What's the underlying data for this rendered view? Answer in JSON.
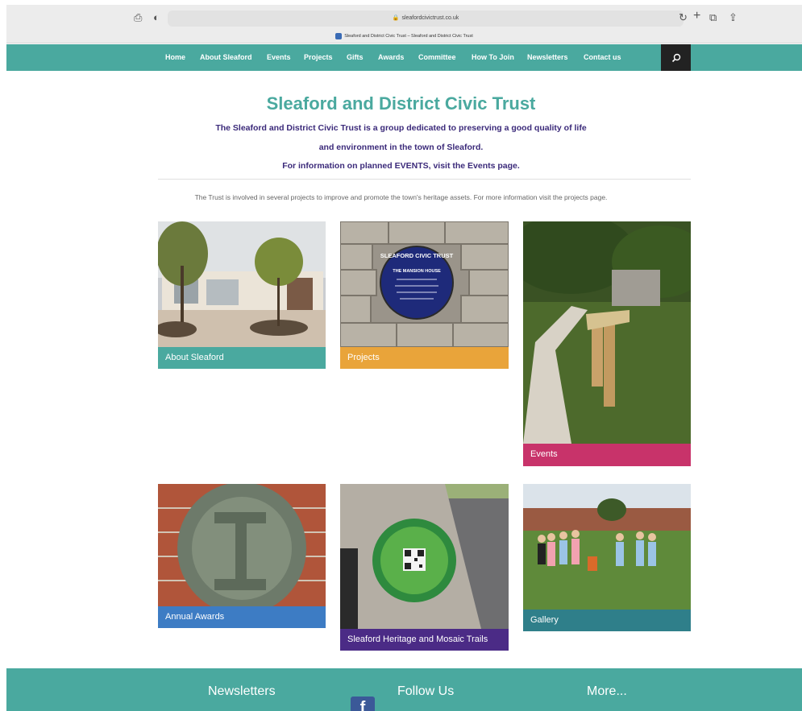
{
  "browser": {
    "url": "sleafordcivictrust.co.uk",
    "tab_title": "Sleaford and District Civic Trust – Sleaford and District Civic Trust"
  },
  "nav": {
    "items": [
      {
        "label": "Home"
      },
      {
        "label": "About Sleaford"
      },
      {
        "label": "Events"
      },
      {
        "label": "Projects"
      },
      {
        "label": "Gifts"
      },
      {
        "label": "Awards"
      },
      {
        "label": "Committee"
      },
      {
        "label": "How To Join"
      },
      {
        "label": "Newsletters"
      },
      {
        "label": "Contact us"
      }
    ],
    "search_icon": "search-icon"
  },
  "header": {
    "title": "Sleaford and District Civic Trust",
    "intro_line1": "The Sleaford and District Civic Trust is a group dedicated to preserving a good quality of life",
    "intro_line2": "and environment in the town of Sleaford.",
    "intro_line3": "For information on planned EVENTS, visit the Events page.",
    "lead": "The Trust is involved in several projects to improve and promote the town's heritage assets. For more information visit the projects page."
  },
  "tiles": [
    {
      "caption": "About Sleaford",
      "color": "#4aa99f"
    },
    {
      "caption": "Projects",
      "color": "#e9a43a"
    },
    {
      "caption": "Events",
      "color": "#c8336a"
    },
    {
      "caption": "Annual Awards",
      "color": "#3d7cc4"
    },
    {
      "caption": "Sleaford Heritage and Mosaic Trails",
      "color": "#4b2b86"
    },
    {
      "caption": "Gallery",
      "color": "#2f7f8a"
    }
  ],
  "plaque": {
    "title": "SLEAFORD CIVIC TRUST",
    "house": "THE MANSION HOUSE"
  },
  "footer": {
    "newsletters": "Newsletters",
    "follow_us": "Follow Us",
    "more": "More..."
  },
  "colors": {
    "brand_teal": "#4aa99f",
    "heading_purple": "#3b2a7a"
  }
}
